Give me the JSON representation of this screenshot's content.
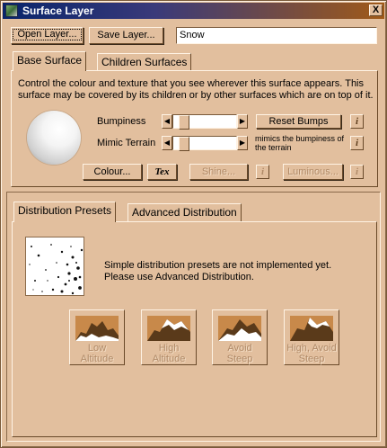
{
  "window": {
    "title": "Surface Layer",
    "close_label": "X"
  },
  "toolbar": {
    "open_label": "Open Layer...",
    "save_label": "Save Layer...",
    "layer_name": "Snow"
  },
  "top_tabs": [
    {
      "label": "Base Surface"
    },
    {
      "label": "Children Surfaces"
    }
  ],
  "base": {
    "description": "Control the colour and texture that you see wherever this surface appears. This surface may be covered by its children or by other surfaces which are on top of it.",
    "bumpiness_label": "Bumpiness",
    "reset_bumps_label": "Reset Bumps",
    "mimic_label": "Mimic Terrain",
    "mimic_hint": "mimics the bumpiness of the terrain",
    "colour_label": "Colour...",
    "tex_label": "Tex",
    "shine_label": "Shine...",
    "luminous_label": "Luminous...",
    "info_glyph": "i",
    "bumpiness_value": 0.1,
    "mimic_value": 0.1
  },
  "dist_tabs": [
    {
      "label": "Distribution Presets"
    },
    {
      "label": "Advanced Distribution"
    }
  ],
  "dist": {
    "message_line1": "Simple distribution presets are not implemented yet.",
    "message_line2": "Please use Advanced Distribution.",
    "presets": [
      {
        "line1": "Low",
        "line2": "Altitude"
      },
      {
        "line1": "High",
        "line2": "Altitude"
      },
      {
        "line1": "Avoid",
        "line2": "Steep"
      },
      {
        "line1": "High, Avoid",
        "line2": "Steep"
      }
    ]
  },
  "colors": {
    "face": "#e2bf9e",
    "title_start": "#08246b",
    "title_end": "#a05a18",
    "preset_image": "#c8894a"
  }
}
